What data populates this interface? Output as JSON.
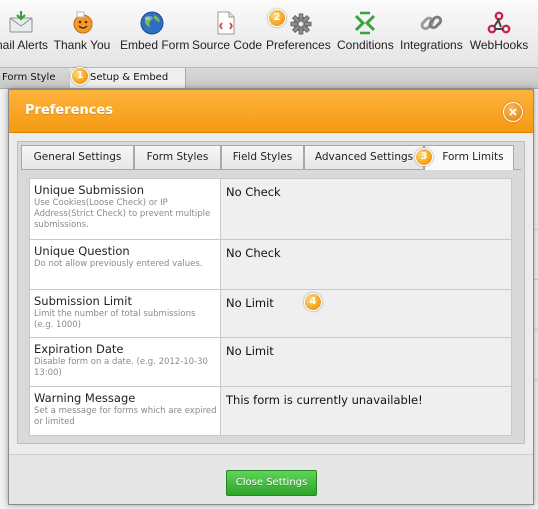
{
  "toolbar": {
    "items": [
      {
        "label": "nail Alerts",
        "icon": "email-alerts-icon"
      },
      {
        "label": "Thank You",
        "icon": "thank-you-icon"
      },
      {
        "label": "Embed Form",
        "icon": "embed-globe-icon"
      },
      {
        "label": "Source Code",
        "icon": "source-code-icon"
      },
      {
        "label": "Preferences",
        "icon": "gear-icon"
      },
      {
        "label": "Conditions",
        "icon": "conditions-icon"
      },
      {
        "label": "Integrations",
        "icon": "chain-link-icon"
      },
      {
        "label": "WebHooks",
        "icon": "webhooks-icon"
      }
    ]
  },
  "bg_tabs": {
    "form_style": "Form Style",
    "setup_embed": "Setup & Embed"
  },
  "markers": [
    "1",
    "2",
    "3",
    "4"
  ],
  "modal": {
    "title": "Preferences",
    "tabs": [
      {
        "label": "General Settings"
      },
      {
        "label": "Form Styles"
      },
      {
        "label": "Field Styles"
      },
      {
        "label": "Advanced Settings"
      },
      {
        "label": "Form Limits",
        "active": true
      }
    ],
    "settings": [
      {
        "title": "Unique Submission",
        "description": "Use Cookies(Loose Check) or IP Address(Strict Check) to prevent multiple submissions.",
        "value": "No Check"
      },
      {
        "title": "Unique Question",
        "description": "Do not allow previously entered values.",
        "value": "No Check"
      },
      {
        "title": "Submission Limit",
        "description": "Limit the number of total submissions (e.g. 1000)",
        "value": "No Limit"
      },
      {
        "title": "Expiration Date",
        "description": "Disable form on a date. (e.g. 2012-10-30 13:00)",
        "value": "No Limit"
      },
      {
        "title": "Warning Message",
        "description": "Set a message for forms which are expired or limited",
        "value": "This form is currently unavailable!"
      }
    ],
    "close_button": "Close Settings"
  },
  "colors": {
    "header": "#f7a21b",
    "close_button": "#3bb935",
    "marker": "#f39c12"
  }
}
